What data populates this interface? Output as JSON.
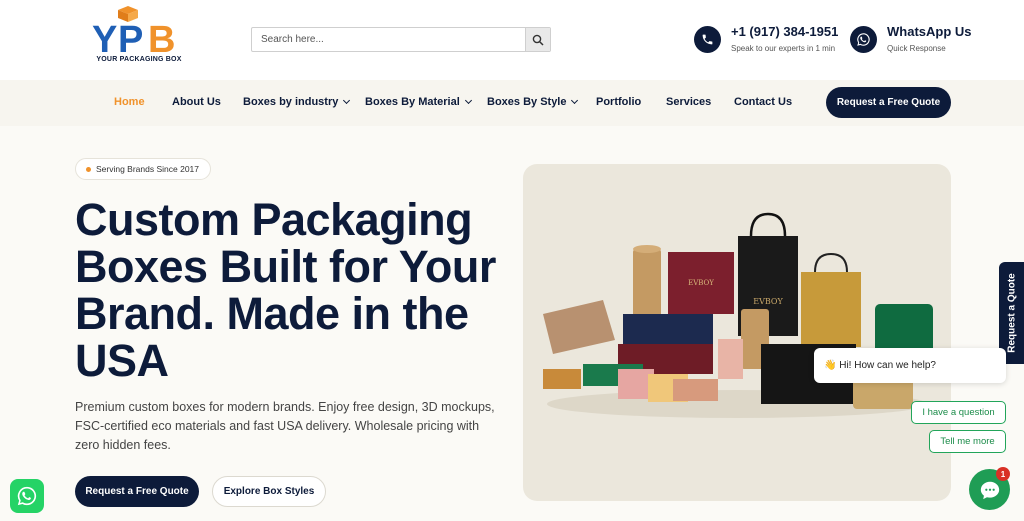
{
  "header": {
    "logo_text": "YOUR PACKAGING BOX",
    "logo_letters": "YPB",
    "search_placeholder": "Search here...",
    "phone": {
      "number": "+1 (917) 384-1951",
      "sub": "Speak to our experts in 1 min",
      "icon": "phone-icon"
    },
    "whatsapp": {
      "title": "WhatsApp Us",
      "sub": "Quick Response",
      "icon": "whatsapp-icon"
    }
  },
  "nav": {
    "items": [
      {
        "label": "Home",
        "active": true,
        "dropdown": false
      },
      {
        "label": "About Us",
        "dropdown": false
      },
      {
        "label": "Boxes by industry",
        "dropdown": true
      },
      {
        "label": "Boxes By Material",
        "dropdown": true
      },
      {
        "label": "Boxes By Style",
        "dropdown": true
      },
      {
        "label": "Portfolio",
        "dropdown": false
      },
      {
        "label": "Services",
        "dropdown": false
      },
      {
        "label": "Contact Us",
        "dropdown": false
      }
    ],
    "cta": "Request a Free Quote"
  },
  "hero": {
    "badge": "Serving Brands Since 2017",
    "headline_lines": [
      "Custom Packaging",
      "Boxes Built for Your",
      "Brand. Made in the",
      "USA"
    ],
    "description": "Premium custom boxes for modern brands. Enjoy free design, 3D mockups, FSC-certified eco materials and fast USA delivery. Wholesale pricing with zero hidden fees.",
    "primary_button": "Request a Free Quote",
    "secondary_button": "Explore Box Styles",
    "product_brand": "EVBOY"
  },
  "side_tab": {
    "label": "Request a Quote"
  },
  "chat": {
    "greeting": "👋 Hi! How can we help?",
    "options": [
      "I have a question",
      "Tell me more"
    ],
    "unread_count": "1"
  },
  "colors": {
    "navy": "#0d1b3a",
    "accent": "#f0922b",
    "green": "#1f9d55",
    "whatsapp": "#25d366"
  }
}
